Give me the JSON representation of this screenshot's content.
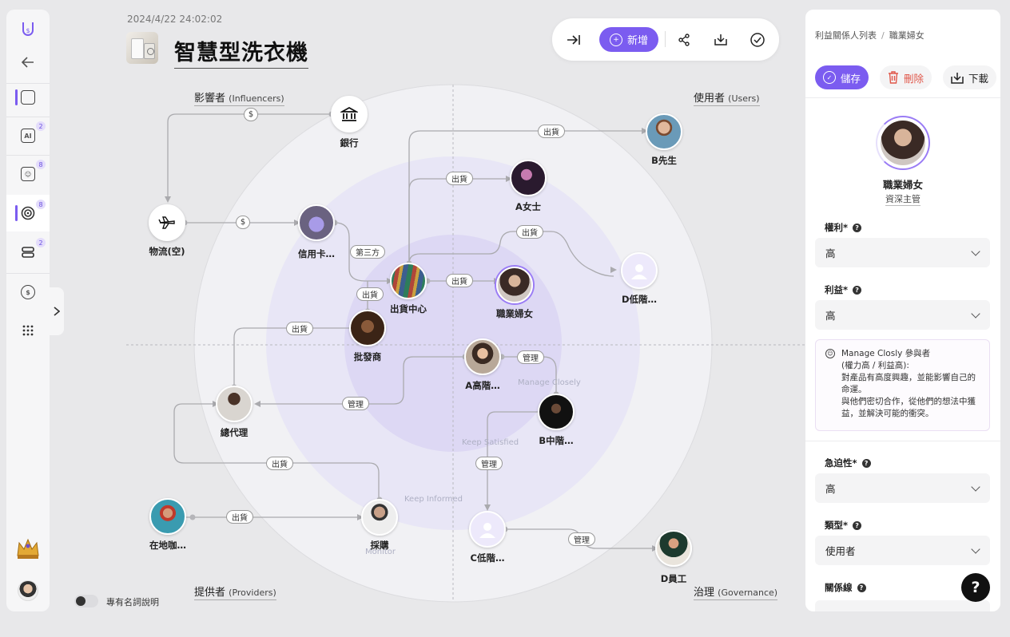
{
  "sidebar": {
    "items": [
      {
        "name": "logo-icon"
      },
      {
        "name": "back-arrow-icon"
      },
      {
        "name": "folder-icon"
      },
      {
        "name": "ai-folder-icon",
        "badge": "2",
        "glyph": "AI"
      },
      {
        "name": "contact-card-icon",
        "badge": "8"
      },
      {
        "name": "target-icon",
        "badge": "8"
      },
      {
        "name": "stack-icon",
        "badge": "2"
      },
      {
        "name": "coin-icon",
        "glyph": "$"
      },
      {
        "name": "grid-icon"
      }
    ]
  },
  "header": {
    "timestamp": "2024/4/22 24:02:02",
    "title": "智慧型洗衣機"
  },
  "toolbar": {
    "add_label": "新增"
  },
  "quadrants": {
    "influencers": {
      "label": "影響者",
      "sub": "(Influencers)"
    },
    "users": {
      "label": "使用者",
      "sub": "(Users)"
    },
    "providers": {
      "label": "提供者",
      "sub": "(Providers)"
    },
    "governance": {
      "label": "治理",
      "sub": "(Governance)"
    }
  },
  "rings": {
    "manage_closely": "Manage Closely",
    "keep_satisfied": "Keep Satisfied",
    "keep_informed": "Keep Informed",
    "monitor": "Monitor"
  },
  "nodes": {
    "bank": "銀行",
    "logistics": "物流(空)",
    "credit_card": "信用卡…",
    "shipping_center": "出貨中心",
    "wholesaler": "批發商",
    "agent": "總代理",
    "local_coffee": "在地咖…",
    "procurement": "採購",
    "mr_b": "B先生",
    "ms_a": "A女士",
    "career_woman": "職業婦女",
    "d_low": "D低階…",
    "a_high": "A高階…",
    "b_mid": "B中階…",
    "c_low": "C低階…",
    "d_staff": "D員工"
  },
  "edges": {
    "ship": "出貨",
    "money": "$",
    "third_party": "第三方",
    "manage": "管理"
  },
  "legend": {
    "toggle_label": "專有名詞說明"
  },
  "panel": {
    "breadcrumb": [
      "利益關係人列表",
      "職業婦女"
    ],
    "actions": {
      "save": "儲存",
      "delete": "刪除",
      "download": "下載"
    },
    "profile": {
      "name": "職業婦女",
      "role": "資深主管"
    },
    "fields": {
      "power": {
        "label": "權利*",
        "value": "高"
      },
      "interest": {
        "label": "利益*",
        "value": "高"
      },
      "urgency": {
        "label": "急迫性*",
        "value": "高"
      },
      "type": {
        "label": "類型*",
        "value": "使用者"
      },
      "relation": {
        "label": "關係線"
      }
    },
    "info": {
      "title": "Manage Closly 參與者",
      "subtitle": "(權力高 / 利益高):",
      "line1": "對產品有高度興趣，並能影響自己的命運。",
      "line2": "與他們密切合作，從他們的想法中獲益，並解決可能的衝突。"
    }
  },
  "colors": {
    "accent": "#7b5cf0",
    "danger": "#e0574a",
    "ring_outer": "#f1f1f4",
    "ring_mid": "#e8e6f6",
    "ring_inner": "#ddd8f4"
  }
}
